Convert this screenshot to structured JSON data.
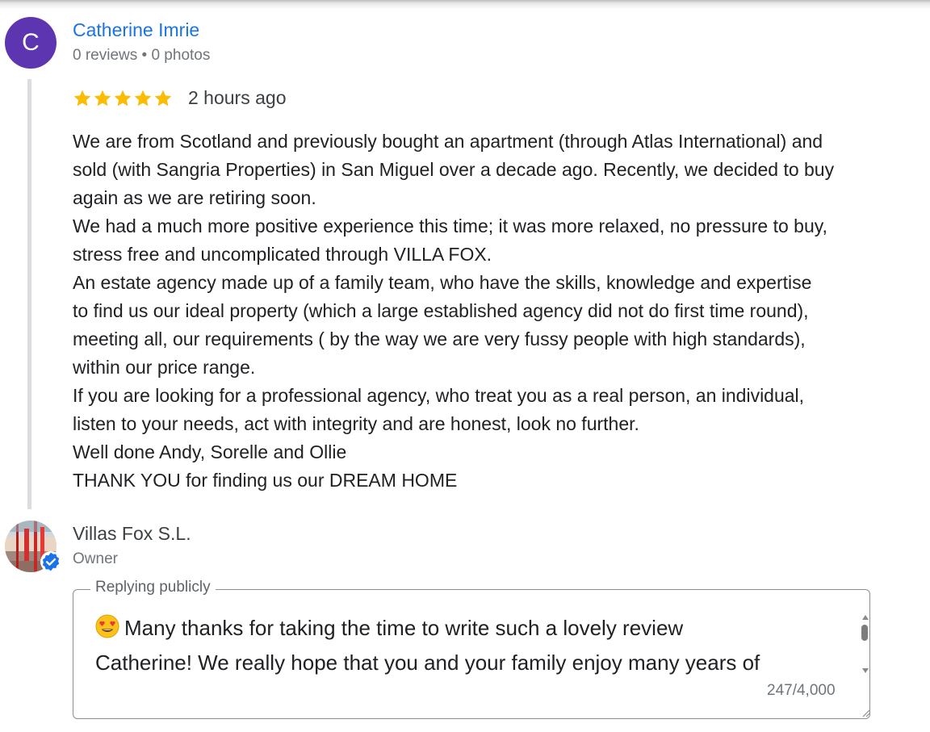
{
  "review": {
    "avatar_letter": "C",
    "reviewer_name": "Catherine Imrie",
    "reviewer_meta": "0 reviews • 0 photos",
    "rating": 5,
    "star_color": "#fbbc04",
    "timestamp": "2 hours ago",
    "lines": [
      "We are from Scotland and previously bought an apartment (through Atlas International) and",
      "sold (with Sangria Properties) in San Miguel over a decade ago. Recently, we decided to buy",
      "again as we are retiring soon.",
      "We had a much more positive experience this time; it was more relaxed, no pressure to buy,",
      "stress free and uncomplicated through VILLA FOX.",
      "An estate agency made up of a family team, who have the skills, knowledge and expertise",
      "to find us our ideal property (which a large established agency did not do first time round),",
      "meeting all, our requirements ( by the way we are very fussy people with high standards),",
      "within our price range.",
      "If you are looking for a professional agency, who treat you as a real person, an individual,",
      "listen to your needs, act with integrity and are honest, look no further.",
      "Well done Andy, Sorelle and Ollie",
      "THANK YOU for finding us our DREAM HOME"
    ]
  },
  "owner": {
    "name": "Villas Fox S.L.",
    "role": "Owner",
    "verified_icon": "verified-badge-icon"
  },
  "reply": {
    "legend": "Replying publicly",
    "emoji": "smiling-face-with-heart-eyes",
    "line1": "Many thanks for taking the time to write such a lovely review",
    "line2": "Catherine!  We really hope that you and your family enjoy many years of",
    "counter": "247/4,000"
  },
  "colors": {
    "link_blue": "#1a73e8",
    "avatar_purple": "#5e35b1",
    "star_yellow": "#fbbc04",
    "verified_blue": "#1a73e8"
  }
}
